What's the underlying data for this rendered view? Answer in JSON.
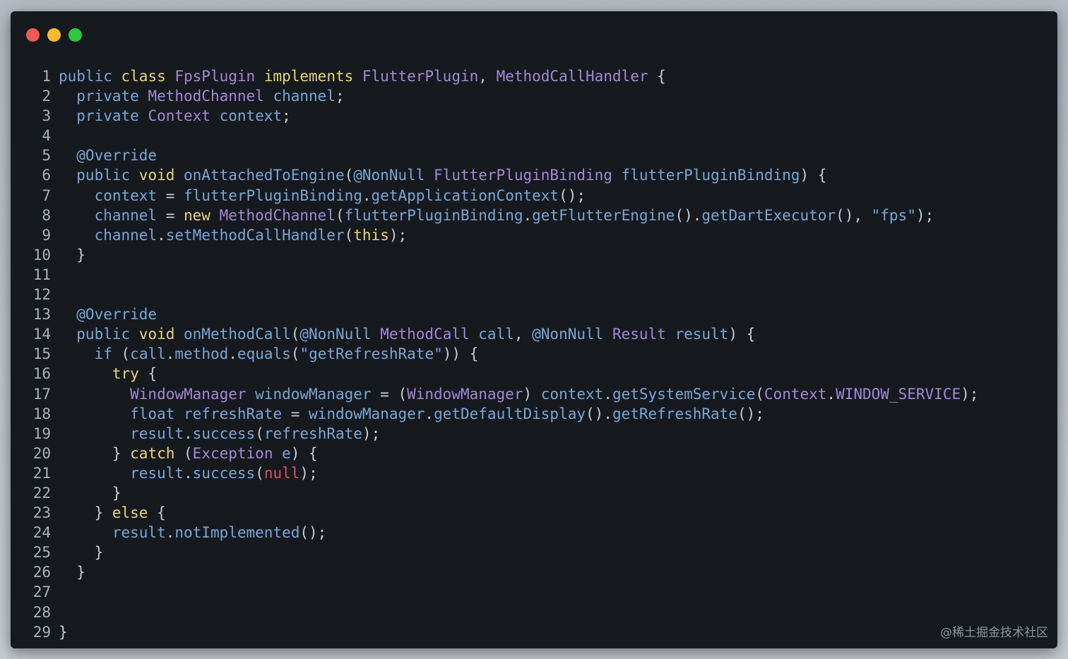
{
  "window": {
    "controls": [
      {
        "name": "close-button",
        "color": "#ee5a52"
      },
      {
        "name": "minimize-button",
        "color": "#f6bb2e"
      },
      {
        "name": "maximize-button",
        "color": "#2ec843"
      }
    ]
  },
  "colors": {
    "background": "#161a1f",
    "kw": "#7aa6d6",
    "kw2": "#e6d679",
    "type": "#a488d6",
    "id": "#7aa6d6",
    "method": "#7aa6d6",
    "punct": "#c8cdd4",
    "str": "#7aa6d6",
    "null": "#e0505e",
    "ann": "#7aa6d6",
    "const": "#a488d6",
    "ln": "#aab1bb"
  },
  "code": {
    "lines": [
      {
        "n": "1",
        "tokens": [
          [
            "kw",
            "public "
          ],
          [
            "kw2",
            "class "
          ],
          [
            "type",
            "FpsPlugin "
          ],
          [
            "kw2",
            "implements "
          ],
          [
            "type",
            "FlutterPlugin"
          ],
          [
            "punct",
            ", "
          ],
          [
            "type",
            "MethodCallHandler "
          ],
          [
            "punct",
            "{"
          ]
        ]
      },
      {
        "n": "2",
        "tokens": [
          [
            "kw",
            "  private "
          ],
          [
            "type",
            "MethodChannel "
          ],
          [
            "id",
            "channel"
          ],
          [
            "punct",
            ";"
          ]
        ]
      },
      {
        "n": "3",
        "tokens": [
          [
            "kw",
            "  private "
          ],
          [
            "type",
            "Context "
          ],
          [
            "id",
            "context"
          ],
          [
            "punct",
            ";"
          ]
        ]
      },
      {
        "n": "4",
        "tokens": []
      },
      {
        "n": "5",
        "tokens": [
          [
            "ann",
            "  @Override"
          ]
        ]
      },
      {
        "n": "6",
        "tokens": [
          [
            "kw",
            "  public "
          ],
          [
            "kw2",
            "void "
          ],
          [
            "method",
            "onAttachedToEngine"
          ],
          [
            "punct",
            "("
          ],
          [
            "ann",
            "@NonNull "
          ],
          [
            "type",
            "FlutterPluginBinding "
          ],
          [
            "id",
            "flutterPluginBinding"
          ],
          [
            "punct",
            ") {"
          ]
        ]
      },
      {
        "n": "7",
        "tokens": [
          [
            "id",
            "    context "
          ],
          [
            "punct",
            "= "
          ],
          [
            "id",
            "flutterPluginBinding"
          ],
          [
            "punct",
            "."
          ],
          [
            "method",
            "getApplicationContext"
          ],
          [
            "punct",
            "();"
          ]
        ]
      },
      {
        "n": "8",
        "tokens": [
          [
            "id",
            "    channel "
          ],
          [
            "punct",
            "= "
          ],
          [
            "kw2",
            "new "
          ],
          [
            "type",
            "MethodChannel"
          ],
          [
            "punct",
            "("
          ],
          [
            "id",
            "flutterPluginBinding"
          ],
          [
            "punct",
            "."
          ],
          [
            "method",
            "getFlutterEngine"
          ],
          [
            "punct",
            "()."
          ],
          [
            "method",
            "getDartExecutor"
          ],
          [
            "punct",
            "(), "
          ],
          [
            "str",
            "\"fps\""
          ],
          [
            "punct",
            ");"
          ]
        ]
      },
      {
        "n": "9",
        "tokens": [
          [
            "id",
            "    channel"
          ],
          [
            "punct",
            "."
          ],
          [
            "method",
            "setMethodCallHandler"
          ],
          [
            "punct",
            "("
          ],
          [
            "kw2",
            "this"
          ],
          [
            "punct",
            ");"
          ]
        ]
      },
      {
        "n": "10",
        "tokens": [
          [
            "punct",
            "  }"
          ]
        ]
      },
      {
        "n": "11",
        "tokens": []
      },
      {
        "n": "12",
        "tokens": []
      },
      {
        "n": "13",
        "tokens": [
          [
            "ann",
            "  @Override"
          ]
        ]
      },
      {
        "n": "14",
        "tokens": [
          [
            "kw",
            "  public "
          ],
          [
            "kw2",
            "void "
          ],
          [
            "method",
            "onMethodCall"
          ],
          [
            "punct",
            "("
          ],
          [
            "ann",
            "@NonNull "
          ],
          [
            "type",
            "MethodCall "
          ],
          [
            "id",
            "call"
          ],
          [
            "punct",
            ", "
          ],
          [
            "ann",
            "@NonNull "
          ],
          [
            "type",
            "Result "
          ],
          [
            "id",
            "result"
          ],
          [
            "punct",
            ") {"
          ]
        ]
      },
      {
        "n": "15",
        "tokens": [
          [
            "kw",
            "    if "
          ],
          [
            "punct",
            "("
          ],
          [
            "id",
            "call"
          ],
          [
            "punct",
            "."
          ],
          [
            "id",
            "method"
          ],
          [
            "punct",
            "."
          ],
          [
            "method",
            "equals"
          ],
          [
            "punct",
            "("
          ],
          [
            "str",
            "\"getRefreshRate\""
          ],
          [
            "punct",
            ")) {"
          ]
        ]
      },
      {
        "n": "16",
        "tokens": [
          [
            "kw2",
            "      try "
          ],
          [
            "punct",
            "{"
          ]
        ]
      },
      {
        "n": "17",
        "tokens": [
          [
            "type",
            "        WindowManager "
          ],
          [
            "id",
            "windowManager "
          ],
          [
            "punct",
            "= ("
          ],
          [
            "type",
            "WindowManager"
          ],
          [
            "punct",
            ") "
          ],
          [
            "id",
            "context"
          ],
          [
            "punct",
            "."
          ],
          [
            "method",
            "getSystemService"
          ],
          [
            "punct",
            "("
          ],
          [
            "type",
            "Context"
          ],
          [
            "punct",
            "."
          ],
          [
            "const",
            "WINDOW_SERVICE"
          ],
          [
            "punct",
            ");"
          ]
        ]
      },
      {
        "n": "18",
        "tokens": [
          [
            "kw",
            "        float "
          ],
          [
            "id",
            "refreshRate "
          ],
          [
            "punct",
            "= "
          ],
          [
            "id",
            "windowManager"
          ],
          [
            "punct",
            "."
          ],
          [
            "method",
            "getDefaultDisplay"
          ],
          [
            "punct",
            "()."
          ],
          [
            "method",
            "getRefreshRate"
          ],
          [
            "punct",
            "();"
          ]
        ]
      },
      {
        "n": "19",
        "tokens": [
          [
            "id",
            "        result"
          ],
          [
            "punct",
            "."
          ],
          [
            "method",
            "success"
          ],
          [
            "punct",
            "("
          ],
          [
            "id",
            "refreshRate"
          ],
          [
            "punct",
            ");"
          ]
        ]
      },
      {
        "n": "20",
        "tokens": [
          [
            "punct",
            "      } "
          ],
          [
            "kw2",
            "catch "
          ],
          [
            "punct",
            "("
          ],
          [
            "type",
            "Exception "
          ],
          [
            "id",
            "e"
          ],
          [
            "punct",
            ") {"
          ]
        ]
      },
      {
        "n": "21",
        "tokens": [
          [
            "id",
            "        result"
          ],
          [
            "punct",
            "."
          ],
          [
            "method",
            "success"
          ],
          [
            "punct",
            "("
          ],
          [
            "null",
            "null"
          ],
          [
            "punct",
            ");"
          ]
        ]
      },
      {
        "n": "22",
        "tokens": [
          [
            "punct",
            "      }"
          ]
        ]
      },
      {
        "n": "23",
        "tokens": [
          [
            "punct",
            "    } "
          ],
          [
            "kw2",
            "else "
          ],
          [
            "punct",
            "{"
          ]
        ]
      },
      {
        "n": "24",
        "tokens": [
          [
            "id",
            "      result"
          ],
          [
            "punct",
            "."
          ],
          [
            "method",
            "notImplemented"
          ],
          [
            "punct",
            "();"
          ]
        ]
      },
      {
        "n": "25",
        "tokens": [
          [
            "punct",
            "    }"
          ]
        ]
      },
      {
        "n": "26",
        "tokens": [
          [
            "punct",
            "  }"
          ]
        ]
      },
      {
        "n": "27",
        "tokens": []
      },
      {
        "n": "28",
        "tokens": []
      },
      {
        "n": "29",
        "tokens": [
          [
            "punct",
            "}"
          ]
        ]
      }
    ]
  },
  "watermark": "@稀土掘金技术社区"
}
